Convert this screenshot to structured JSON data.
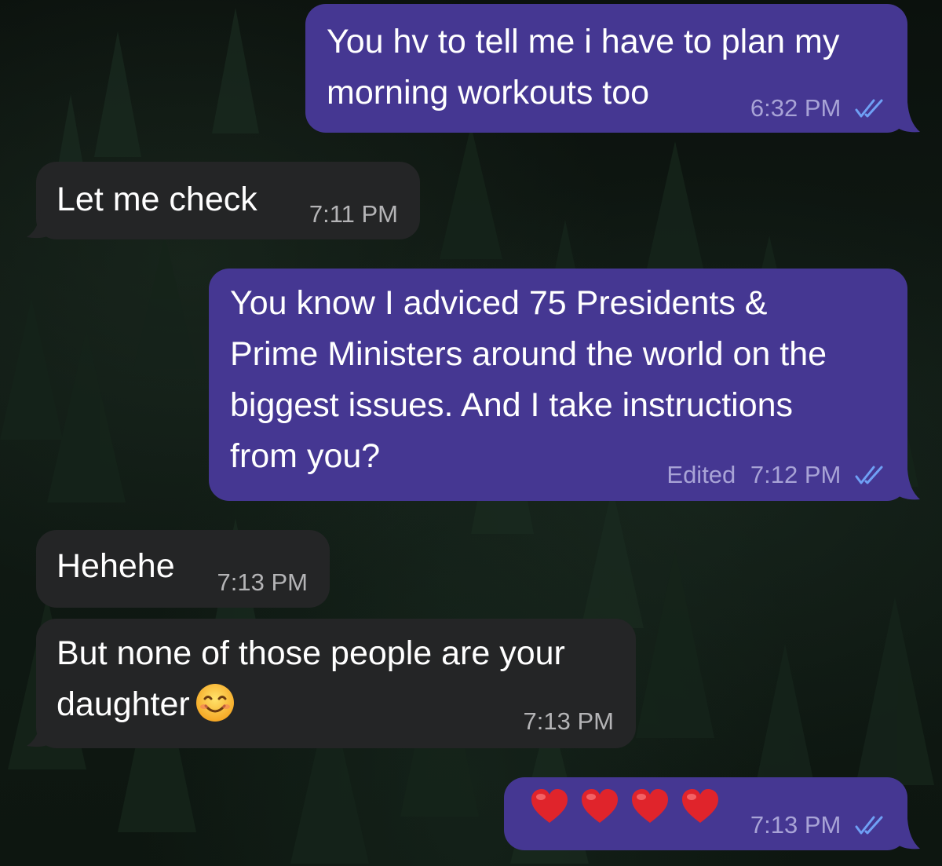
{
  "chat": {
    "messages": [
      {
        "id": "m1",
        "direction": "outgoing",
        "text": "You hv to tell me i have to plan my\nmorning workouts too",
        "time": "6:32 PM",
        "read_status": "double-check-read"
      },
      {
        "id": "m2",
        "direction": "incoming",
        "text": "Let me check",
        "time": "7:11 PM"
      },
      {
        "id": "m3",
        "direction": "outgoing",
        "text": "You know I adviced 75 Presidents &\nPrime Ministers around the world on the\nbiggest issues. And I take instructions\nfrom you?",
        "edited_label": "Edited",
        "time": "7:12 PM",
        "read_status": "double-check-read"
      },
      {
        "id": "m4",
        "direction": "incoming",
        "text": "Hehehe",
        "time": "7:13 PM"
      },
      {
        "id": "m5",
        "direction": "incoming",
        "text": "But none of those people are your\ndaughter",
        "emoji": "smiling-face-emoji",
        "time": "7:13 PM"
      },
      {
        "id": "m6",
        "direction": "outgoing",
        "text": "",
        "emojis": [
          "red-heart-emoji",
          "red-heart-emoji",
          "red-heart-emoji",
          "red-heart-emoji"
        ],
        "time": "7:13 PM",
        "read_status": "double-check-read"
      }
    ]
  },
  "colors": {
    "outgoing_bubble": "#453792",
    "incoming_bubble": "#242526",
    "read_check": "#6fa0f5",
    "wallpaper": "#0c130f"
  }
}
